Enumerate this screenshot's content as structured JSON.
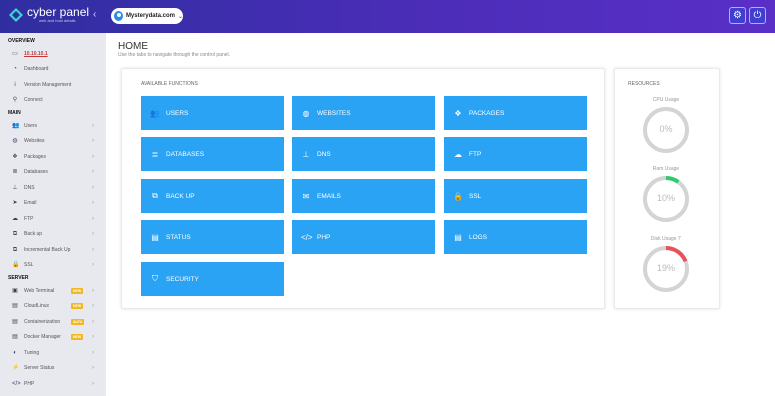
{
  "brand": {
    "name": "cyber panel",
    "tagline": "web and host details"
  },
  "topbar": {
    "site_name": "Mysterydata.com"
  },
  "sidebar": {
    "overview_heading": "OVERVIEW",
    "overview_items": [
      {
        "label": "10.10.10.1",
        "icon": "desktop-icon"
      },
      {
        "label": "Dashboard",
        "icon": "dashboard-icon"
      },
      {
        "label": "Version Management",
        "icon": "info-icon"
      },
      {
        "label": "Connect",
        "icon": "connect-icon"
      }
    ],
    "main_heading": "MAIN",
    "main_items": [
      {
        "label": "Users",
        "icon": "users-icon"
      },
      {
        "label": "Websites",
        "icon": "globe-icon"
      },
      {
        "label": "Packages",
        "icon": "packages-icon"
      },
      {
        "label": "Databases",
        "icon": "database-icon"
      },
      {
        "label": "DNS",
        "icon": "sitemap-icon"
      },
      {
        "label": "Email",
        "icon": "send-icon"
      },
      {
        "label": "FTP",
        "icon": "cloud-upload-icon"
      },
      {
        "label": "Back up",
        "icon": "copy-icon"
      },
      {
        "label": "Incremental Back Up",
        "icon": "copy-icon"
      },
      {
        "label": "SSL",
        "icon": "lock-icon"
      }
    ],
    "server_heading": "SERVER",
    "server_items": [
      {
        "label": "Web Terminal",
        "icon": "terminal-icon",
        "badge": "NEW"
      },
      {
        "label": "CloudLinux",
        "icon": "file-icon",
        "badge": "NEW"
      },
      {
        "label": "Containerization",
        "icon": "file-icon",
        "badge": "ALFA"
      },
      {
        "label": "Docker Manager",
        "icon": "file-icon",
        "badge": "NEW"
      },
      {
        "label": "Tuning",
        "icon": "tuning-icon"
      },
      {
        "label": "Server Status",
        "icon": "bolt-icon"
      },
      {
        "label": "PHP",
        "icon": "code-icon"
      }
    ]
  },
  "page": {
    "title": "HOME",
    "subtitle": "Use the tabs to navigate through the control panel."
  },
  "functions": {
    "title": "AVAILABLE FUNCTIONS",
    "items": [
      {
        "label": "USERS",
        "icon": "users-icon"
      },
      {
        "label": "WEBSITES",
        "icon": "globe-icon"
      },
      {
        "label": "PACKAGES",
        "icon": "packages-icon"
      },
      {
        "label": "DATABASES",
        "icon": "database-icon"
      },
      {
        "label": "DNS",
        "icon": "sitemap-icon"
      },
      {
        "label": "FTP",
        "icon": "cloud-upload-icon"
      },
      {
        "label": "BACK UP",
        "icon": "copy-icon"
      },
      {
        "label": "EMAILS",
        "icon": "envelope-icon"
      },
      {
        "label": "SSL",
        "icon": "lock-icon"
      },
      {
        "label": "STATUS",
        "icon": "server-icon"
      },
      {
        "label": "PHP",
        "icon": "code-icon"
      },
      {
        "label": "LOGS",
        "icon": "file-icon"
      },
      {
        "label": "SECURITY",
        "icon": "shield-icon"
      }
    ]
  },
  "resources": {
    "title": "RESOURCES",
    "gauges": [
      {
        "label": "CPU Usage",
        "value": "0%",
        "percent": 0,
        "color": "#2ecc71"
      },
      {
        "label": "Ram Usage",
        "value": "10%",
        "percent": 10,
        "color": "#2ecc71"
      },
      {
        "label": "Disk Usage '/'",
        "value": "19%",
        "percent": 19,
        "color": "#e8505b"
      }
    ]
  },
  "colors": {
    "accent": "#2aa3f5",
    "topbar": "#4b2db8",
    "badge": "#f3b821"
  }
}
